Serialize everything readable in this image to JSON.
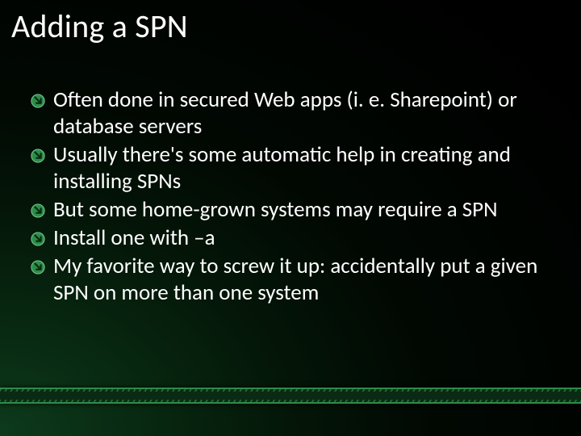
{
  "title": "Adding a SPN",
  "bullets": [
    "Often done in secured Web apps (i. e. Sharepoint) or database servers",
    "Usually there's some automatic help in creating and installing SPNs",
    "But some home-grown systems may require a SPN",
    "Install one with –a",
    "My favorite way to screw it up:  accidentally put a given SPN on more than one system"
  ]
}
